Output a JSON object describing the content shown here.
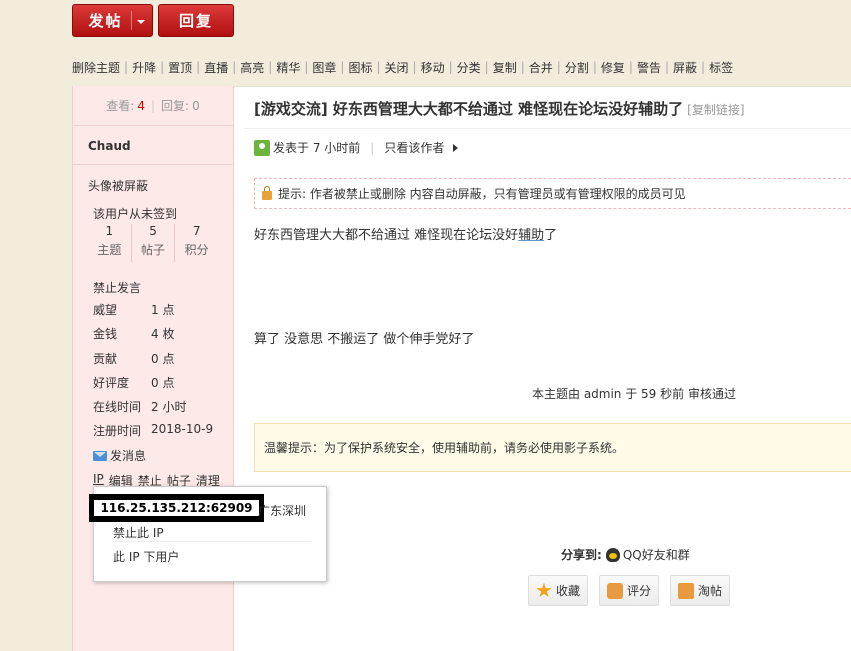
{
  "toolbar": {
    "post_label": "发帖",
    "reply_label": "回复"
  },
  "mod_actions": [
    "删除主题",
    "升降",
    "置顶",
    "直播",
    "高亮",
    "精华",
    "图章",
    "图标",
    "关闭",
    "移动",
    "分类",
    "复制",
    "合并",
    "分割",
    "修复",
    "警告",
    "屏蔽",
    "标签"
  ],
  "stats": {
    "views_label": "查看:",
    "views": "4",
    "replies_label": "回复:",
    "replies": "0"
  },
  "user": {
    "name": "Chaud",
    "avatar_blocked": "头像被屏蔽",
    "never_signed": "该用户从未签到",
    "counts": [
      {
        "value": "1",
        "label": "主题"
      },
      {
        "value": "5",
        "label": "帖子"
      },
      {
        "value": "7",
        "label": "积分"
      }
    ],
    "banned": "禁止发言",
    "info": [
      {
        "k": "威望",
        "v": "1 点"
      },
      {
        "k": "金钱",
        "v": "4 枚"
      },
      {
        "k": "贡献",
        "v": "0 点"
      },
      {
        "k": "好评度",
        "v": "0 点"
      },
      {
        "k": "在线时间",
        "v": "2 小时"
      },
      {
        "k": "注册时间",
        "v": "2018-10-9"
      }
    ],
    "send_message": "发消息",
    "admin_links": {
      "ip": "IP",
      "edit": "编辑",
      "ban": "禁止",
      "posts": "帖子",
      "clean": "清理"
    }
  },
  "ip_popup": {
    "ip": "116.25.135.212:62909",
    "location": "广东深圳",
    "ban_ip": "禁止此 IP",
    "ip_users": "此 IP 下用户"
  },
  "post": {
    "title": "[游戏交流] 好东西管理大大都不给通过 难怪现在论坛没好辅助了",
    "copy_link": "[复制链接]",
    "posted_at": "发表于 7 小时前",
    "only_author": "只看该作者",
    "notice": "提示: 作者被禁止或删除 内容自动屏蔽，只有管理员或有管理权限的成员可见",
    "body_line1_a": "好东西管理大大都不给通过 难怪现在论坛没好",
    "body_line1_link": "辅助",
    "body_line1_b": "了",
    "body_line2": "算了 没意思 不搬运了  做个伸手党好了",
    "review": "本主题由 admin 于 59 秒前 审核通过",
    "tip": "温馨提示：为了保护系统安全，使用辅助前，请务必使用影子系统。",
    "share_label": "分享到:",
    "share_target": "QQ好友和群",
    "actions": {
      "favorite": "收藏",
      "rate": "评分",
      "taobao": "淘帖"
    }
  }
}
